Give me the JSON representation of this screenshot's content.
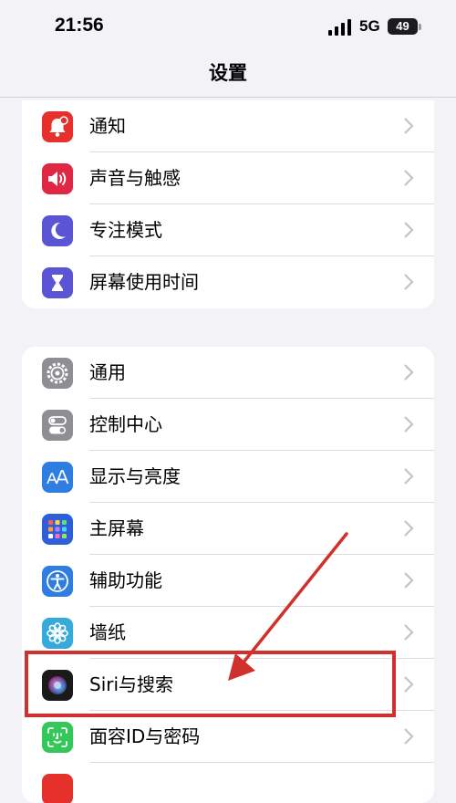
{
  "status_bar": {
    "time": "21:56",
    "network": "5G",
    "battery": "49"
  },
  "nav": {
    "title": "设置"
  },
  "group1": [
    {
      "label": "通知",
      "icon": "bell-icon",
      "color": "#e5302c"
    },
    {
      "label": "声音与触感",
      "icon": "speaker-icon",
      "color": "#e02845"
    },
    {
      "label": "专注模式",
      "icon": "moon-icon",
      "color": "#5b55d6"
    },
    {
      "label": "屏幕使用时间",
      "icon": "hourglass-icon",
      "color": "#5b55d6"
    }
  ],
  "group2": [
    {
      "label": "通用",
      "icon": "gear-icon",
      "color": "#8e8e93"
    },
    {
      "label": "控制中心",
      "icon": "toggles-icon",
      "color": "#8e8e93"
    },
    {
      "label": "显示与亮度",
      "icon": "text-size-icon",
      "color": "#2f7de1"
    },
    {
      "label": "主屏幕",
      "icon": "app-grid-icon",
      "color": "#2f5fd8"
    },
    {
      "label": "辅助功能",
      "icon": "accessibility-icon",
      "color": "#2f7de1"
    },
    {
      "label": "墙纸",
      "icon": "flower-icon",
      "color": "#37aadc"
    },
    {
      "label": "Siri与搜索",
      "icon": "siri-icon",
      "color": "#1a1a1a"
    },
    {
      "label": "面容ID与密码",
      "icon": "face-id-icon",
      "color": "#34c759"
    }
  ],
  "annotation": {
    "color": "#d0312d",
    "highlighted_item": "Siri与搜索"
  }
}
